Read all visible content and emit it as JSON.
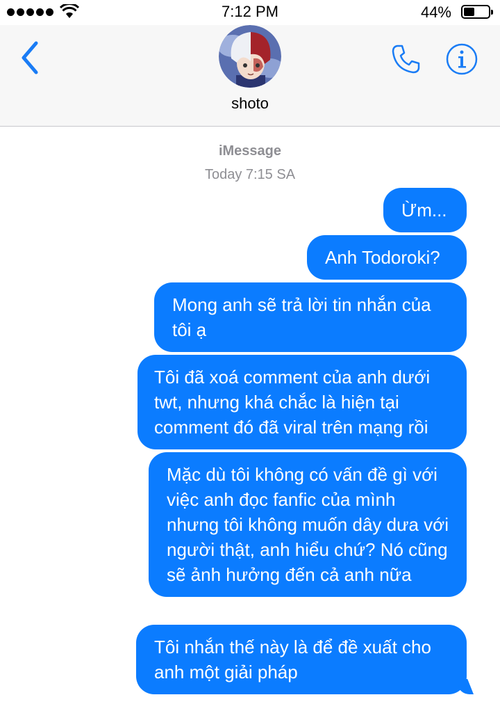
{
  "status_bar": {
    "time": "7:12 PM",
    "battery_percent": "44%",
    "battery_level": 0.44
  },
  "header": {
    "contact_name": "shoto",
    "icons": {
      "back": "chevron-left-icon",
      "phone": "phone-icon",
      "info": "info-icon"
    },
    "accent_color": "#1a7cf5"
  },
  "conversation": {
    "service_label": "iMessage",
    "timestamp": "Today 7:15 SA",
    "bubble_color": "#0b7cff",
    "messages": [
      {
        "text": "Ừm..."
      },
      {
        "text": "Anh Todoroki?"
      },
      {
        "text": "Mong anh sẽ trả lời tin nhắn của tôi ạ"
      },
      {
        "text": "Tôi đã xoá comment của anh dưới twt, nhưng khá chắc là hiện tại comment đó đã viral trên mạng rồi"
      },
      {
        "text": "Mặc dù tôi không có vấn đề gì với việc anh đọc fanfic của mình nhưng tôi không muốn dây dưa với người thật, anh hiểu chứ? Nó cũng sẽ ảnh hưởng đến cả anh nữa"
      },
      {
        "text": "Tôi nhắn thế này là để đề xuất cho anh một giải pháp"
      }
    ]
  }
}
